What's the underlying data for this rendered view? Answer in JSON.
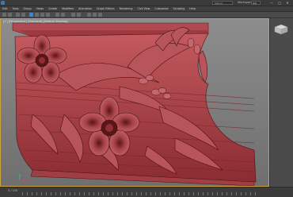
{
  "titlebar": {
    "search_placeholder": "Sign in",
    "workspace_label": "Workspace:",
    "workspace_value": "Def",
    "minimize": "—",
    "maximize": "□",
    "close": "✕"
  },
  "menu": [
    "Edit",
    "Tools",
    "Group",
    "Views",
    "Create",
    "Modifiers",
    "Animation",
    "Graph Editors",
    "Rendering",
    "Civil View",
    "Customize",
    "Scripting",
    "Help"
  ],
  "viewport": {
    "label": "[+] [Perspective] [Standard] [Default Shading]"
  },
  "status": {
    "frame_counter": "0 / 100"
  },
  "colors": {
    "model": "#b0454a",
    "model_dark": "#5a1518",
    "viewport_bg": "#7f7f7f",
    "selection_border": "#cfa23a",
    "accent": "#2b7cc1"
  }
}
